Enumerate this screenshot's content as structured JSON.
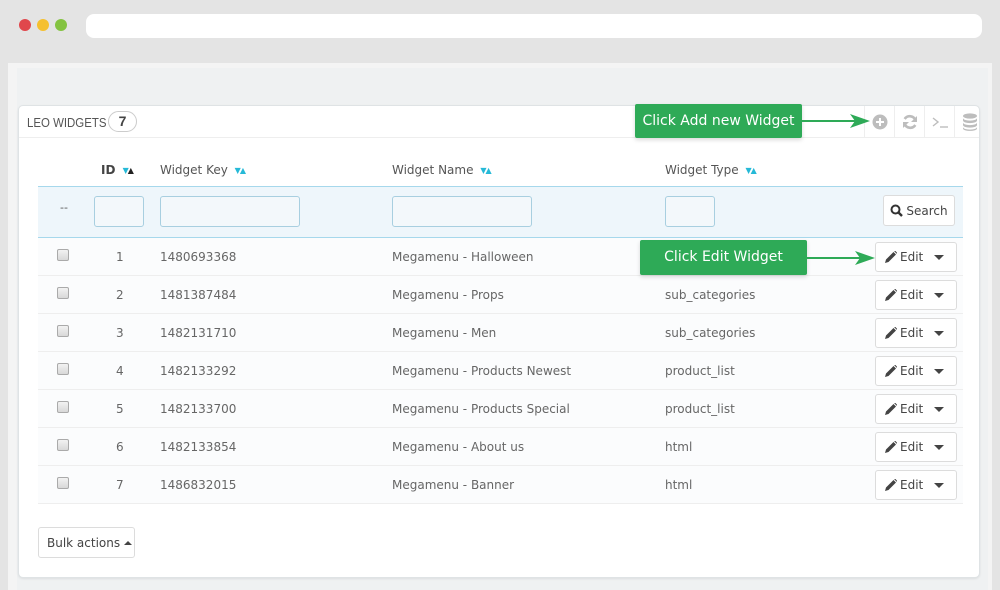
{
  "browser": {
    "window_controls": [
      "close",
      "minimize",
      "maximize"
    ],
    "address": ""
  },
  "panel": {
    "title": "LEO WIDGETS",
    "count": "7",
    "toolbar": [
      {
        "name": "add-new-icon",
        "glyph": "+"
      },
      {
        "name": "refresh-icon",
        "glyph": "refresh"
      },
      {
        "name": "sql-query-icon",
        "glyph": ">_"
      },
      {
        "name": "database-icon",
        "glyph": "db"
      }
    ]
  },
  "callouts": {
    "add": "Click Add new Widget",
    "edit": "Click Edit Widget"
  },
  "table": {
    "columns": [
      {
        "label": "ID",
        "sortable": true,
        "active": true
      },
      {
        "label": "Widget Key",
        "sortable": true
      },
      {
        "label": "Widget Name",
        "sortable": true
      },
      {
        "label": "Widget Type",
        "sortable": true
      }
    ],
    "filter": {
      "dash": "--",
      "id_value": "",
      "key_value": "",
      "name_value": "",
      "type_value": "",
      "search_label": "Search"
    },
    "rows": [
      {
        "id": "1",
        "key": "1480693368",
        "name": "Megamenu - Halloween",
        "type": "",
        "action": "Edit"
      },
      {
        "id": "2",
        "key": "1481387484",
        "name": "Megamenu - Props",
        "type": "sub_categories",
        "action": "Edit"
      },
      {
        "id": "3",
        "key": "1482131710",
        "name": "Megamenu - Men",
        "type": "sub_categories",
        "action": "Edit"
      },
      {
        "id": "4",
        "key": "1482133292",
        "name": "Megamenu - Products Newest",
        "type": "product_list",
        "action": "Edit"
      },
      {
        "id": "5",
        "key": "1482133700",
        "name": "Megamenu - Products Special",
        "type": "product_list",
        "action": "Edit"
      },
      {
        "id": "6",
        "key": "1482133854",
        "name": "Megamenu - About us",
        "type": "html",
        "action": "Edit"
      },
      {
        "id": "7",
        "key": "1486832015",
        "name": "Megamenu - Banner",
        "type": "html",
        "action": "Edit"
      }
    ]
  },
  "bulk_actions": {
    "label": "Bulk actions"
  },
  "colors": {
    "callout": "#2eaa57",
    "sort_arrow": "#25b9d7",
    "filter_bg": "#eef6fb"
  }
}
